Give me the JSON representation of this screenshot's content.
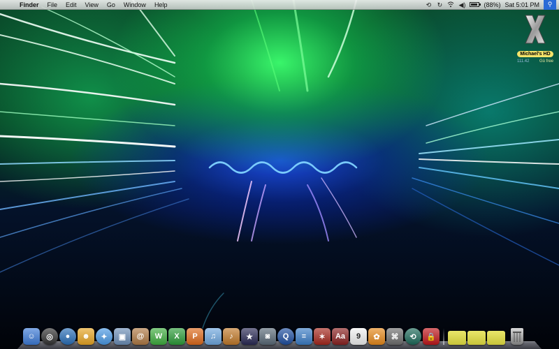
{
  "menubar": {
    "apple": "",
    "app_name": "Finder",
    "items": [
      "File",
      "Edit",
      "View",
      "Go",
      "Window",
      "Help"
    ],
    "battery_percent": 88,
    "battery_text": "(88%)",
    "clock": "Sat 5:01 PM",
    "status_icons": [
      "time-machine-icon",
      "sync-icon",
      "wifi-icon",
      "volume-icon",
      "battery-icon",
      "spotlight-icon"
    ]
  },
  "desktop": {
    "disk": {
      "name": "Michael's HD",
      "capacity": "111.42",
      "free": "Gü free",
      "icon": "mac-os-x-disk-icon"
    }
  },
  "dock": {
    "apps": [
      {
        "name": "finder-icon",
        "color": "#3d7bd8",
        "glyph": "☺"
      },
      {
        "name": "dashboard-icon",
        "color": "#333333",
        "glyph": "◎"
      },
      {
        "name": "google-earth-icon",
        "color": "#2a6fb8",
        "glyph": "●"
      },
      {
        "name": "ichat-icon",
        "color": "#e8a624",
        "glyph": "☻"
      },
      {
        "name": "safari-icon",
        "color": "#4b9ae6",
        "glyph": "✦"
      },
      {
        "name": "preview-icon",
        "color": "#6d8fb8",
        "glyph": "▣"
      },
      {
        "name": "address-book-icon",
        "color": "#b07a45",
        "glyph": "@"
      },
      {
        "name": "word-icon",
        "color": "#3fae3f",
        "glyph": "W"
      },
      {
        "name": "excel-icon",
        "color": "#2d9d3a",
        "glyph": "X"
      },
      {
        "name": "powerpoint-icon",
        "color": "#e06b1c",
        "glyph": "P"
      },
      {
        "name": "itunes-icon",
        "color": "#6fa8e0",
        "glyph": "♫"
      },
      {
        "name": "garageband-icon",
        "color": "#c27a2a",
        "glyph": "♪"
      },
      {
        "name": "imovie-icon",
        "color": "#2a2a55",
        "glyph": "★"
      },
      {
        "name": "iphoto-icon",
        "color": "#5a6a78",
        "glyph": "◙"
      },
      {
        "name": "quicktime-icon",
        "color": "#1f4fa0",
        "glyph": "Q"
      },
      {
        "name": "app-banner-icon",
        "color": "#3c7ec8",
        "glyph": "≡"
      },
      {
        "name": "game-icon",
        "color": "#a6281e",
        "glyph": "✶"
      },
      {
        "name": "dictionary-icon",
        "color": "#8b2222",
        "glyph": "Aa"
      },
      {
        "name": "ical-icon",
        "color": "#f2f2f2",
        "glyph": "9"
      },
      {
        "name": "flower-icon",
        "color": "#e88a1c",
        "glyph": "✿"
      },
      {
        "name": "utility-icon",
        "color": "#6f6f6f",
        "glyph": "⌘"
      },
      {
        "name": "time-machine-icon",
        "color": "#1d6a5a",
        "glyph": "⟲"
      },
      {
        "name": "security-lock-icon",
        "color": "#c0161b",
        "glyph": "🔒"
      }
    ],
    "folders": [
      {
        "name": "applications-folder-icon",
        "color": "#c8c43a"
      },
      {
        "name": "documents-folder-icon",
        "color": "#c8c43a"
      },
      {
        "name": "downloads-folder-icon",
        "color": "#c8c43a"
      }
    ],
    "trash": {
      "name": "trash-icon"
    }
  }
}
